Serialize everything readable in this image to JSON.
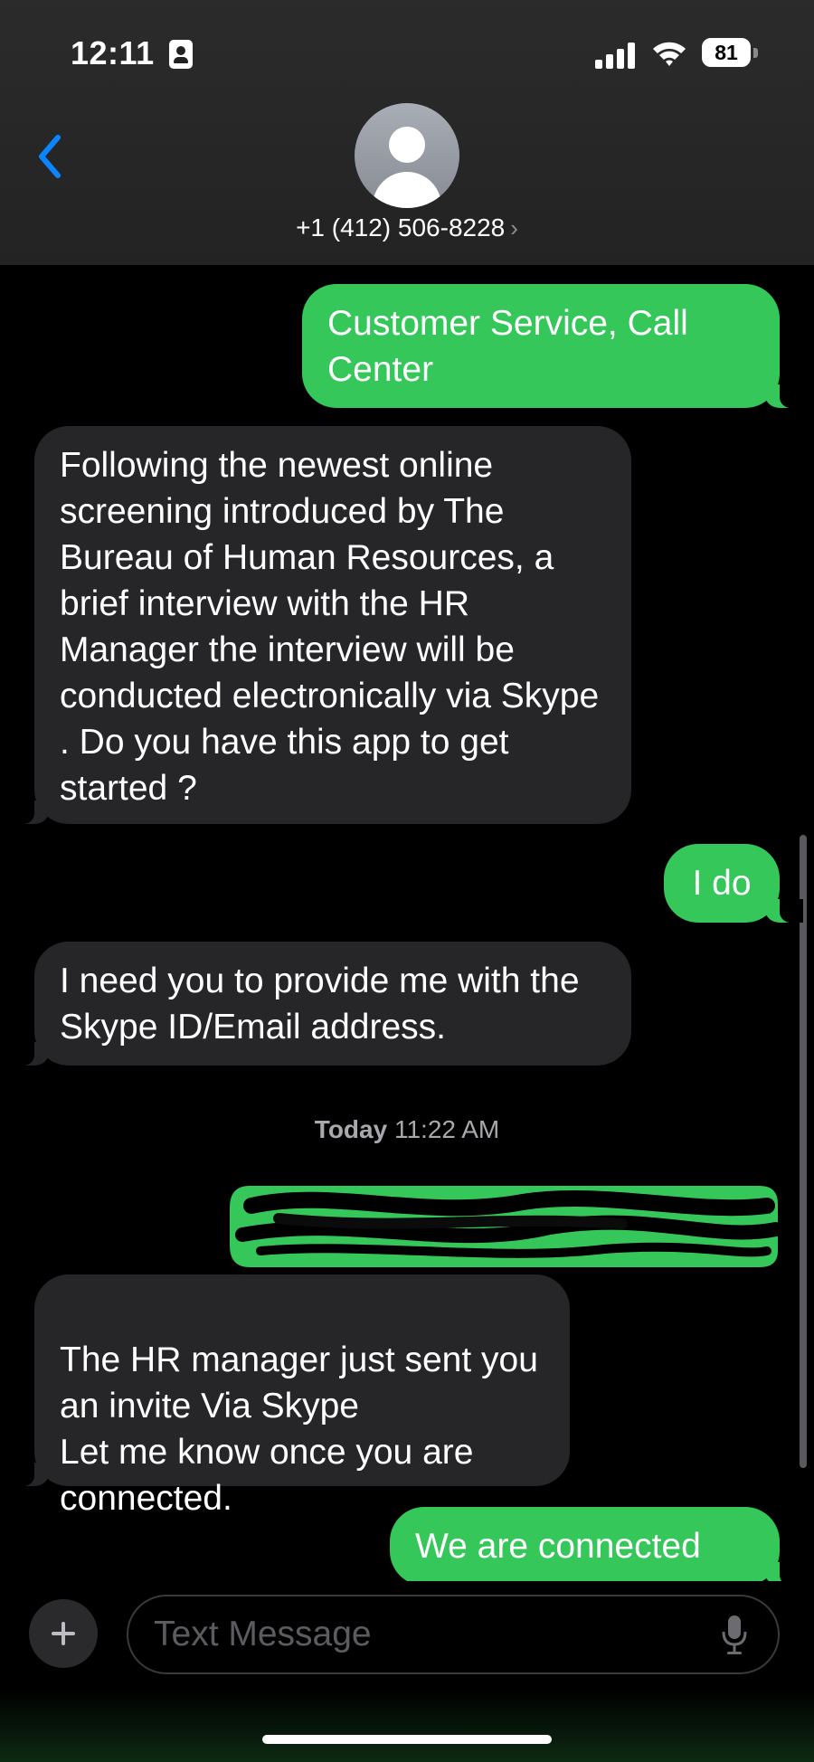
{
  "status_bar": {
    "time": "12:11",
    "battery": "81"
  },
  "header": {
    "contact": "+1 (412) 506-8228",
    "chevron": "›"
  },
  "messages": [
    {
      "from": "me",
      "text": "Customer Service, Call Center"
    },
    {
      "from": "them",
      "text": "Following the newest online screening introduced by The Bureau of Human Resources, a brief interview with the HR Manager the interview will be conducted electronically via Skype . Do you have this app to get started ?"
    },
    {
      "from": "me",
      "text": "I do"
    },
    {
      "from": "them",
      "text": "I need you to provide me with the Skype ID/Email address."
    },
    {
      "from": "them",
      "text": "The HR manager just sent you an invite Via Skype\nLet me know once you are connected."
    },
    {
      "from": "me",
      "text": "We are connected"
    }
  ],
  "timestamp": {
    "day": "Today",
    "time": "11:22 AM"
  },
  "composer": {
    "placeholder": "Text Message"
  },
  "colors": {
    "sent_bubble": "#35c759",
    "received_bubble": "#262628",
    "accent": "#0a84ff"
  }
}
